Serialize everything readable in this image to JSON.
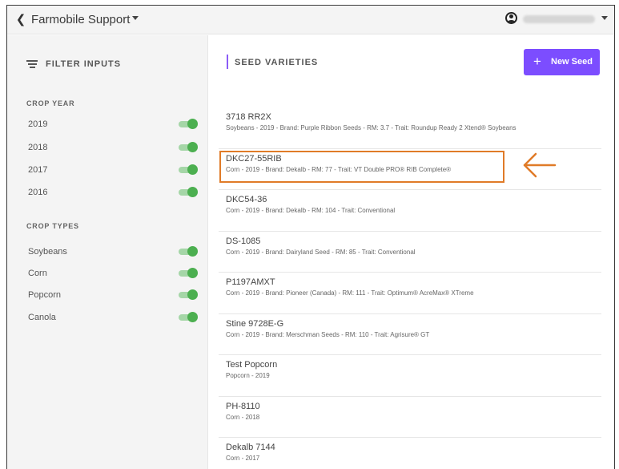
{
  "topbar": {
    "app_title": "Farmobile Support",
    "user_name_blurred": "",
    "icons": {
      "back": "chevron-left-icon",
      "title_caret": "caret-down-icon",
      "user": "user-circle-icon",
      "user_caret": "caret-down-icon"
    }
  },
  "sidebar": {
    "title": "FILTER INPUTS",
    "crop_year_label": "CROP YEAR",
    "crop_years": [
      {
        "label": "2019",
        "on": true
      },
      {
        "label": "2018",
        "on": true
      },
      {
        "label": "2017",
        "on": true
      },
      {
        "label": "2016",
        "on": true
      }
    ],
    "crop_types_label": "CROP TYPES",
    "crop_types": [
      {
        "label": "Soybeans",
        "on": true
      },
      {
        "label": "Corn",
        "on": true
      },
      {
        "label": "Popcorn",
        "on": true
      },
      {
        "label": "Canola",
        "on": true
      }
    ]
  },
  "main": {
    "title": "SEED VARIETIES",
    "new_seed_label": "New Seed",
    "new_seed_icon": "plus-icon",
    "seeds": [
      {
        "name": "3718 RR2X",
        "detail": "Soybeans - 2019 - Brand: Purple Ribbon Seeds - RM: 3.7 - Trait: Roundup Ready 2 Xtend® Soybeans"
      },
      {
        "name": "DKC27-55RIB",
        "detail": "Corn - 2019 - Brand: Dekalb - RM: 77 - Trait: VT Double PRO® RIB Complete®"
      },
      {
        "name": "DKC54-36",
        "detail": "Corn - 2019 - Brand: Dekalb - RM: 104 - Trait: Conventional"
      },
      {
        "name": "DS-1085",
        "detail": "Corn - 2019 - Brand: Dairyland Seed - RM: 85 - Trait: Conventional"
      },
      {
        "name": "P1197AMXT",
        "detail": "Corn - 2019 - Brand: Pioneer (Canada) - RM: 111 - Trait: Optimum® AcreMax® XTreme"
      },
      {
        "name": "Stine 9728E-G",
        "detail": "Corn - 2019 - Brand: Merschman Seeds - RM: 110 - Trait: Agrisure® GT"
      },
      {
        "name": "Test Popcorn",
        "detail": "Popcorn - 2019"
      },
      {
        "name": "PH-8110",
        "detail": "Corn - 2018"
      },
      {
        "name": "Dekalb 7144",
        "detail": "Corn - 2017"
      }
    ]
  },
  "colors": {
    "accent": "#7c4dff",
    "toggle_on": "#4caf50",
    "highlight": "#e07b28"
  }
}
